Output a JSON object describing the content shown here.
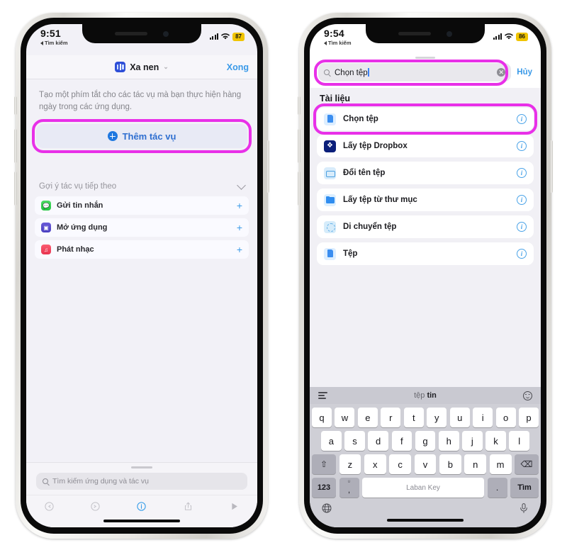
{
  "left_phone": {
    "status_bar": {
      "time": "9:51",
      "back_label": "Tìm kiếm",
      "battery": "87"
    },
    "header": {
      "title": "Xa nen",
      "done_label": "Xong",
      "app_icon": "shortcuts-icon",
      "chevron": "⌄"
    },
    "description": "Tạo một phím tắt cho các tác vụ mà bạn thực hiện hàng ngày trong các ứng dụng.",
    "add_action": {
      "label": "Thêm tác vụ",
      "icon": "plus-circle-icon",
      "highlight_color": "#e830e8"
    },
    "suggestions": {
      "header": "Gợi ý tác vụ tiếp theo",
      "collapse_icon": "chevron-down-icon",
      "items": [
        {
          "label": "Gửi tin nhắn",
          "icon": "messages-icon",
          "color": "#34c759",
          "action": "+"
        },
        {
          "label": "Mở ứng dụng",
          "icon": "open-app-icon",
          "color": "#5a4fd0",
          "action": "+"
        },
        {
          "label": "Phát nhạc",
          "icon": "music-icon",
          "color": "#f0344f",
          "action": "+"
        }
      ]
    },
    "search": {
      "placeholder": "Tìm kiếm ứng dụng và tác vụ",
      "icon": "search-icon"
    },
    "toolbar": [
      {
        "name": "undo-icon",
        "glyph": "↺",
        "active": false
      },
      {
        "name": "redo-icon",
        "glyph": "↻",
        "active": false
      },
      {
        "name": "info-icon",
        "glyph": "i",
        "active": true
      },
      {
        "name": "share-icon",
        "glyph": "↑",
        "active": false
      },
      {
        "name": "play-icon",
        "glyph": "▶",
        "active": false
      }
    ]
  },
  "right_phone": {
    "status_bar": {
      "time": "9:54",
      "back_label": "Tìm kiếm",
      "battery": "86"
    },
    "search": {
      "value": "Chọn tệp",
      "cancel_label": "Hủy",
      "icon": "search-icon",
      "clear_icon": "clear-circle-icon",
      "highlight_color": "#e830e8"
    },
    "section_title": "Tài liệu",
    "results": [
      {
        "label": "Chọn tệp",
        "icon": "document-icon",
        "info": "ⓘ",
        "highlighted": true
      },
      {
        "label": "Lấy tệp Dropbox",
        "icon": "dropbox-icon",
        "info": "ⓘ",
        "highlighted": false
      },
      {
        "label": "Đổi tên tệp",
        "icon": "rename-file-icon",
        "info": "ⓘ",
        "highlighted": false
      },
      {
        "label": "Lấy tệp từ thư mục",
        "icon": "folder-icon",
        "info": "ⓘ",
        "highlighted": false
      },
      {
        "label": "Di chuyển tệp",
        "icon": "move-file-icon",
        "info": "ⓘ",
        "highlighted": false
      },
      {
        "label": "Tệp",
        "icon": "document-icon",
        "info": "ⓘ",
        "highlighted": false
      }
    ],
    "keyboard": {
      "suggestion_bar": {
        "left_icon": "list-icon",
        "suggestion_prefix": "tệp ",
        "suggestion_bold": "tin",
        "right_icon": "emoji-icon"
      },
      "row1": [
        "q",
        "w",
        "e",
        "r",
        "t",
        "y",
        "u",
        "i",
        "o",
        "p"
      ],
      "row2": [
        "a",
        "s",
        "d",
        "f",
        "g",
        "h",
        "j",
        "k",
        "l"
      ],
      "row3": [
        "z",
        "x",
        "c",
        "v",
        "b",
        "n",
        "m"
      ],
      "shift_icon": "shift-icon",
      "backspace_icon": "backspace-icon",
      "numbers_key": "123",
      "comma_key": {
        "sup": "ʋ",
        "main": ","
      },
      "space_key": "Laban Key",
      "dot_key": ".",
      "go_key": "Tìm",
      "globe_icon": "globe-icon",
      "mic_icon": "microphone-icon"
    }
  }
}
